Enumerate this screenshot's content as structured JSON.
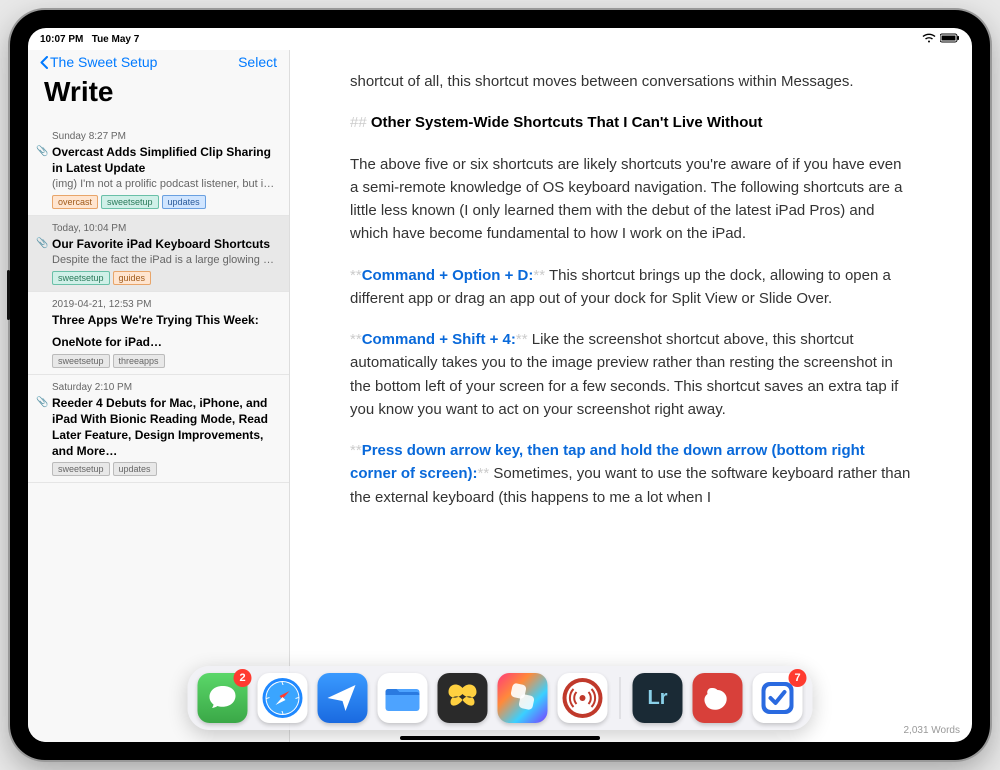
{
  "status": {
    "time": "10:07 PM",
    "date": "Tue May 7"
  },
  "sidebar": {
    "back_label": "The Sweet Setup",
    "select_label": "Select",
    "title": "Write",
    "notes": [
      {
        "date": "Sunday 8:27 PM",
        "title": "Overcast Adds Simplified Clip Sharing in Latest Update",
        "preview": "(img) I'm not a prolific podcast listener, but it…",
        "has_clip": true,
        "tags": [
          {
            "label": "overcast",
            "style": "tag-orange"
          },
          {
            "label": "sweetsetup",
            "style": "tag-teal"
          },
          {
            "label": "updates",
            "style": "tag-blue"
          }
        ]
      },
      {
        "date": "Today, 10:04 PM",
        "title": "Our Favorite iPad Keyboard Shortcuts",
        "preview": "Despite the fact the iPad is a large glowing touchscreen, it almost feels like it was built to…",
        "has_clip": true,
        "selected": true,
        "tags": [
          {
            "label": "sweetsetup",
            "style": "tag-teal"
          },
          {
            "label": "guides",
            "style": "tag-orange"
          }
        ]
      },
      {
        "date": "2019-04-21, 12:53 PM",
        "title": "Three Apps We're Trying This Week:",
        "title2": "OneNote for iPad…",
        "tags": [
          {
            "label": "sweetsetup",
            "style": "tag-gray"
          },
          {
            "label": "threeapps",
            "style": "tag-gray"
          }
        ]
      },
      {
        "date": "Saturday 2:10 PM",
        "title": "Reeder 4 Debuts for Mac, iPhone, and iPad With Bionic Reading Mode, Read Later Feature, Design Improvements, and More…",
        "has_clip": true,
        "tags": [
          {
            "label": "sweetsetup",
            "style": "tag-gray"
          },
          {
            "label": "updates",
            "style": "tag-gray"
          }
        ]
      }
    ]
  },
  "editor": {
    "intro": "shortcut of all, this shortcut moves between conversations within Messages.",
    "heading_marker": "## ",
    "heading": "Other System-Wide Shortcuts That I Can't Live Without",
    "para1": "The above five or six shortcuts are likely shortcuts you're aware of if you have even a semi-remote knowledge of OS keyboard navigation. The following shortcuts are a little less known (I only learned them with the debut of the latest iPad Pros) and which have become fundamental to how I work on the iPad.",
    "sc1_key": "Command + Option + D:",
    "sc1_body": " This shortcut brings up the dock, allowing to open a different app or drag an app out of your dock for Split View or Slide Over.",
    "sc2_key": "Command + Shift + 4:",
    "sc2_body": " Like the screenshot shortcut above, this shortcut automatically takes you to the image preview rather than resting the screenshot in the bottom left of your screen for a few seconds. This shortcut saves an extra tap if you know you want to act on your screenshot right away.",
    "sc3_key": "Press down arrow key, then tap and hold the down arrow (bottom right corner of screen):",
    "sc3_body": " Sometimes, you want to use the software keyboard rather than the external keyboard (this happens to me a lot when I",
    "word_count": "2,031 Words"
  },
  "dock": {
    "apps": [
      {
        "name": "messages-icon",
        "badge": "2",
        "bg": "linear-gradient(#5bd769,#3aa847)",
        "glyph": "message"
      },
      {
        "name": "safari-icon",
        "bg": "#fff",
        "glyph": "safari"
      },
      {
        "name": "mail-icon",
        "bg": "linear-gradient(#3a9aff,#1a6ae0)",
        "glyph": "plane"
      },
      {
        "name": "files-icon",
        "bg": "#fff",
        "glyph": "folder"
      },
      {
        "name": "butterfly-icon",
        "bg": "#2a2a2a",
        "glyph": "butterfly"
      },
      {
        "name": "shortcuts-icon",
        "bg": "linear-gradient(135deg,#ff3b7a,#ff8a3a,#3ad0ff,#7a3aff)",
        "glyph": "shortcuts"
      },
      {
        "name": "overcast-icon",
        "bg": "#fff",
        "glyph": "overcast"
      },
      {
        "name": "lightroom-icon",
        "bg": "#1a2a35",
        "glyph": "lr"
      },
      {
        "name": "bear-icon",
        "bg": "#d8403a",
        "glyph": "bear"
      },
      {
        "name": "things-icon",
        "badge": "7",
        "bg": "#fff",
        "glyph": "things"
      }
    ]
  }
}
